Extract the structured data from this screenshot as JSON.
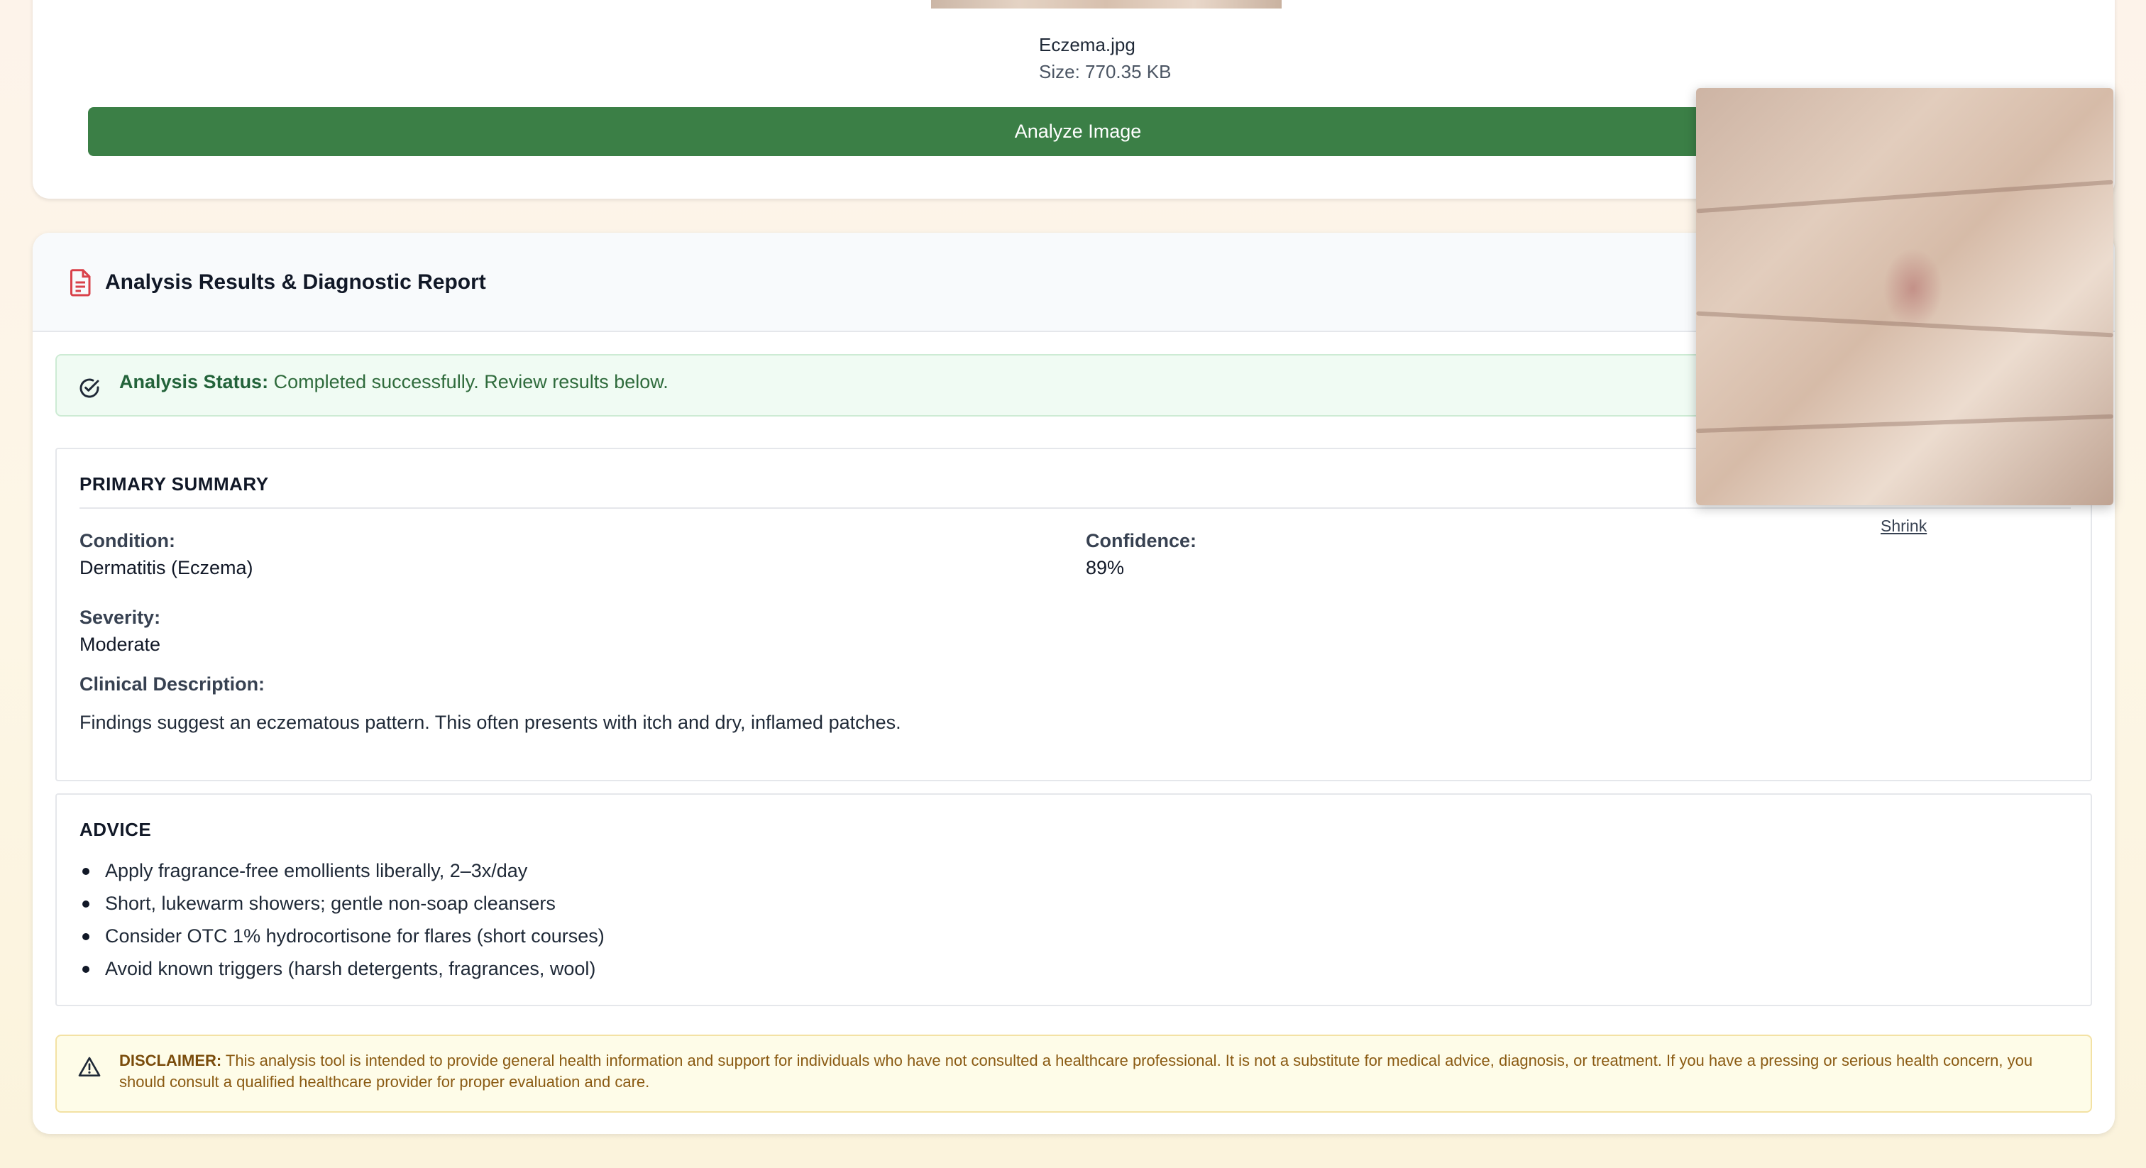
{
  "upload": {
    "file_name": "Eczema.jpg",
    "file_size": "Size: 770.35 KB",
    "analyze_label": "Analyze Image"
  },
  "results": {
    "title": "Analysis Results & Diagnostic Report",
    "status_label": "Analysis Status:",
    "status_text": " Completed successfully. Review results below.",
    "summary": {
      "title": "PRIMARY SUMMARY",
      "condition_label": "Condition:",
      "condition_value": "Dermatitis (Eczema)",
      "confidence_label": "Confidence:",
      "confidence_value": "89%",
      "severity_label": "Severity:",
      "severity_value": "Moderate",
      "description_label": "Clinical Description:",
      "description_text": "Findings suggest an eczematous pattern. This often presents with itch and dry, inflamed patches."
    },
    "advice": {
      "title": "ADVICE",
      "items": [
        "Apply fragrance-free emollients liberally, 2–3x/day",
        "Short, lukewarm showers; gentle non-soap cleansers",
        "Consider OTC 1% hydrocortisone for flares (short courses)",
        "Avoid known triggers (harsh detergents, fragrances, wool)"
      ]
    },
    "disclaimer": {
      "label": "DISCLAIMER:",
      "text": " This analysis tool is intended to provide general health information and support for individuals who have not consulted a healthcare professional. It is not a substitute for medical advice, diagnosis, or treatment. If you have a pressing or serious health concern, you should consult a qualified healthcare provider for proper evaluation and care."
    }
  },
  "zoom": {
    "shrink_label": "Shrink"
  },
  "icons": {
    "report": "document-icon",
    "status": "check-circle-icon",
    "disclaimer": "warning-triangle-icon"
  },
  "colors": {
    "primary_button": "#3b7f46",
    "report_icon": "#d9414a",
    "status_bg": "#f0fbf3",
    "status_text": "#2f6b3c",
    "disclaimer_bg": "#fefce8",
    "disclaimer_text": "#8a5a12"
  }
}
